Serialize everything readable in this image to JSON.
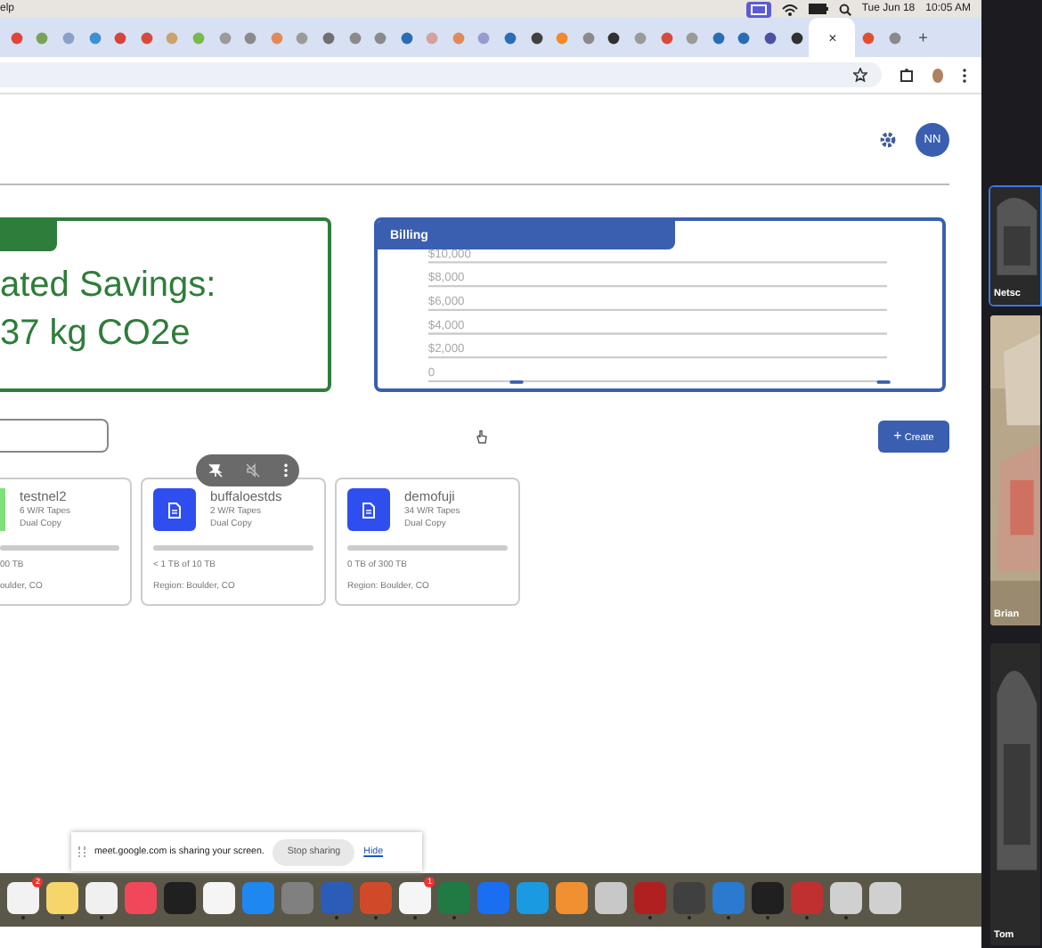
{
  "menubar": {
    "menu": "elp",
    "date": "Tue Jun 18",
    "time": "10:05 AM"
  },
  "tabs": [
    {
      "color": "#e0453a",
      "selected": false
    },
    {
      "color": "#7aa35a",
      "selected": false
    },
    {
      "color": "#8aa0c8",
      "selected": false
    },
    {
      "color": "#3b8fd6",
      "selected": false
    },
    {
      "color": "#d6453a",
      "selected": false
    },
    {
      "color": "#d64b3a",
      "selected": false
    },
    {
      "color": "#c9a36a",
      "selected": false
    },
    {
      "color": "#7ab84a",
      "selected": false
    },
    {
      "color": "#9a9a9a",
      "selected": false
    },
    {
      "color": "#8a8a8a",
      "selected": false
    },
    {
      "color": "#e08a5a",
      "selected": false
    },
    {
      "color": "#9a9a9a",
      "selected": false
    },
    {
      "color": "#707070",
      "selected": false
    },
    {
      "color": "#8a8a8a",
      "selected": false
    },
    {
      "color": "#8a8a8a",
      "selected": false
    },
    {
      "color": "#2a6db5",
      "selected": false
    },
    {
      "color": "#d6a0a0",
      "selected": false
    },
    {
      "color": "#e08a5a",
      "selected": false
    },
    {
      "color": "#9a9ad0",
      "selected": false
    },
    {
      "color": "#2a6db5",
      "selected": false
    },
    {
      "color": "#404040",
      "selected": false
    },
    {
      "color": "#f08a2a",
      "selected": false
    },
    {
      "color": "#8a8a8a",
      "selected": false
    },
    {
      "color": "#303030",
      "selected": false
    },
    {
      "color": "#9a9a9a",
      "selected": false
    },
    {
      "color": "#d64b3a",
      "selected": false
    },
    {
      "color": "#9a9a9a",
      "selected": false
    },
    {
      "color": "#2a6db5",
      "selected": false
    },
    {
      "color": "#2a6db5",
      "selected": false
    },
    {
      "color": "#5050a0",
      "selected": false
    },
    {
      "color": "#303030",
      "selected": false
    },
    {
      "selected": true
    },
    {
      "color": "#e05030",
      "selected": false
    },
    {
      "color": "#8a8a8a",
      "selected": false
    }
  ],
  "tab_close": "×",
  "new_tab": "+",
  "header": {
    "avatar": "NN"
  },
  "savings": {
    "line1": "ated Savings:",
    "line2": "37 kg CO2e"
  },
  "billing": {
    "title": "Billing",
    "chart_data": {
      "type": "bar",
      "values": [
        0,
        0
      ],
      "grid": true,
      "ylim": [
        0,
        10000
      ],
      "yticks": [
        {
          "value": 0,
          "label": "0"
        },
        {
          "value": 2000,
          "label": "$2,000"
        },
        {
          "value": 4000,
          "label": "$4,000"
        },
        {
          "value": 6000,
          "label": "$6,000"
        },
        {
          "value": 8000,
          "label": "$8,000"
        },
        {
          "value": 10000,
          "label": "$10,000"
        }
      ]
    }
  },
  "create_button": {
    "icon": "+",
    "label": "Create"
  },
  "cards": [
    {
      "name": "testnel2",
      "tapes": "6 W/R Tapes",
      "copy": "Dual Copy",
      "usage": "00 TB",
      "region": "oulder, CO",
      "level": 0,
      "icon": false
    },
    {
      "name": "buffaloestds",
      "tapes": "2 W/R Tapes",
      "copy": "Dual Copy",
      "usage": "< 1 TB of 10 TB",
      "region": "Region: Boulder, CO",
      "level": 0,
      "icon": true
    },
    {
      "name": "demofuji",
      "tapes": "34 W/R Tapes",
      "copy": "Dual Copy",
      "usage": "0 TB of 300 TB",
      "region": "Region: Boulder, CO",
      "level": 0,
      "icon": true
    }
  ],
  "share_bar": {
    "message": "meet.google.com is sharing your screen.",
    "stop": "Stop sharing",
    "hide": "Hide"
  },
  "dock": [
    {
      "color": "#f2f2f2",
      "badge": "2",
      "running": true
    },
    {
      "color": "#f6d66a",
      "running": true
    },
    {
      "color": "#f0f0f0",
      "running": true
    },
    {
      "color": "#f0485a",
      "running": false
    },
    {
      "color": "#202020",
      "running": false
    },
    {
      "color": "#f5f5f5",
      "running": false
    },
    {
      "color": "#1e88f0",
      "running": false
    },
    {
      "color": "#808080",
      "running": false
    },
    {
      "color": "#2b5db8",
      "running": true
    },
    {
      "color": "#d04a2a",
      "running": true
    },
    {
      "color": "#f5f5f5",
      "badge": "1",
      "running": true
    },
    {
      "color": "#1f7a44",
      "running": true
    },
    {
      "color": "#1a6ef0",
      "running": false
    },
    {
      "color": "#1a9ae0",
      "running": false
    },
    {
      "color": "#f09030",
      "running": false
    },
    {
      "color": "#c8c8c8",
      "running": false
    },
    {
      "color": "#b02020",
      "running": true
    },
    {
      "color": "#404040",
      "running": true
    },
    {
      "color": "#2a7ad0",
      "running": true
    },
    {
      "color": "#202020",
      "running": true
    },
    {
      "color": "#c03030",
      "running": true
    },
    {
      "color": "#d0d0d0",
      "running": true
    },
    {
      "color": "#d0d0d0",
      "running": false
    }
  ],
  "participants": [
    {
      "name": "Netsc",
      "selected": true
    },
    {
      "name": "Brian",
      "selected": false
    },
    {
      "name": "Tom",
      "selected": false
    }
  ]
}
